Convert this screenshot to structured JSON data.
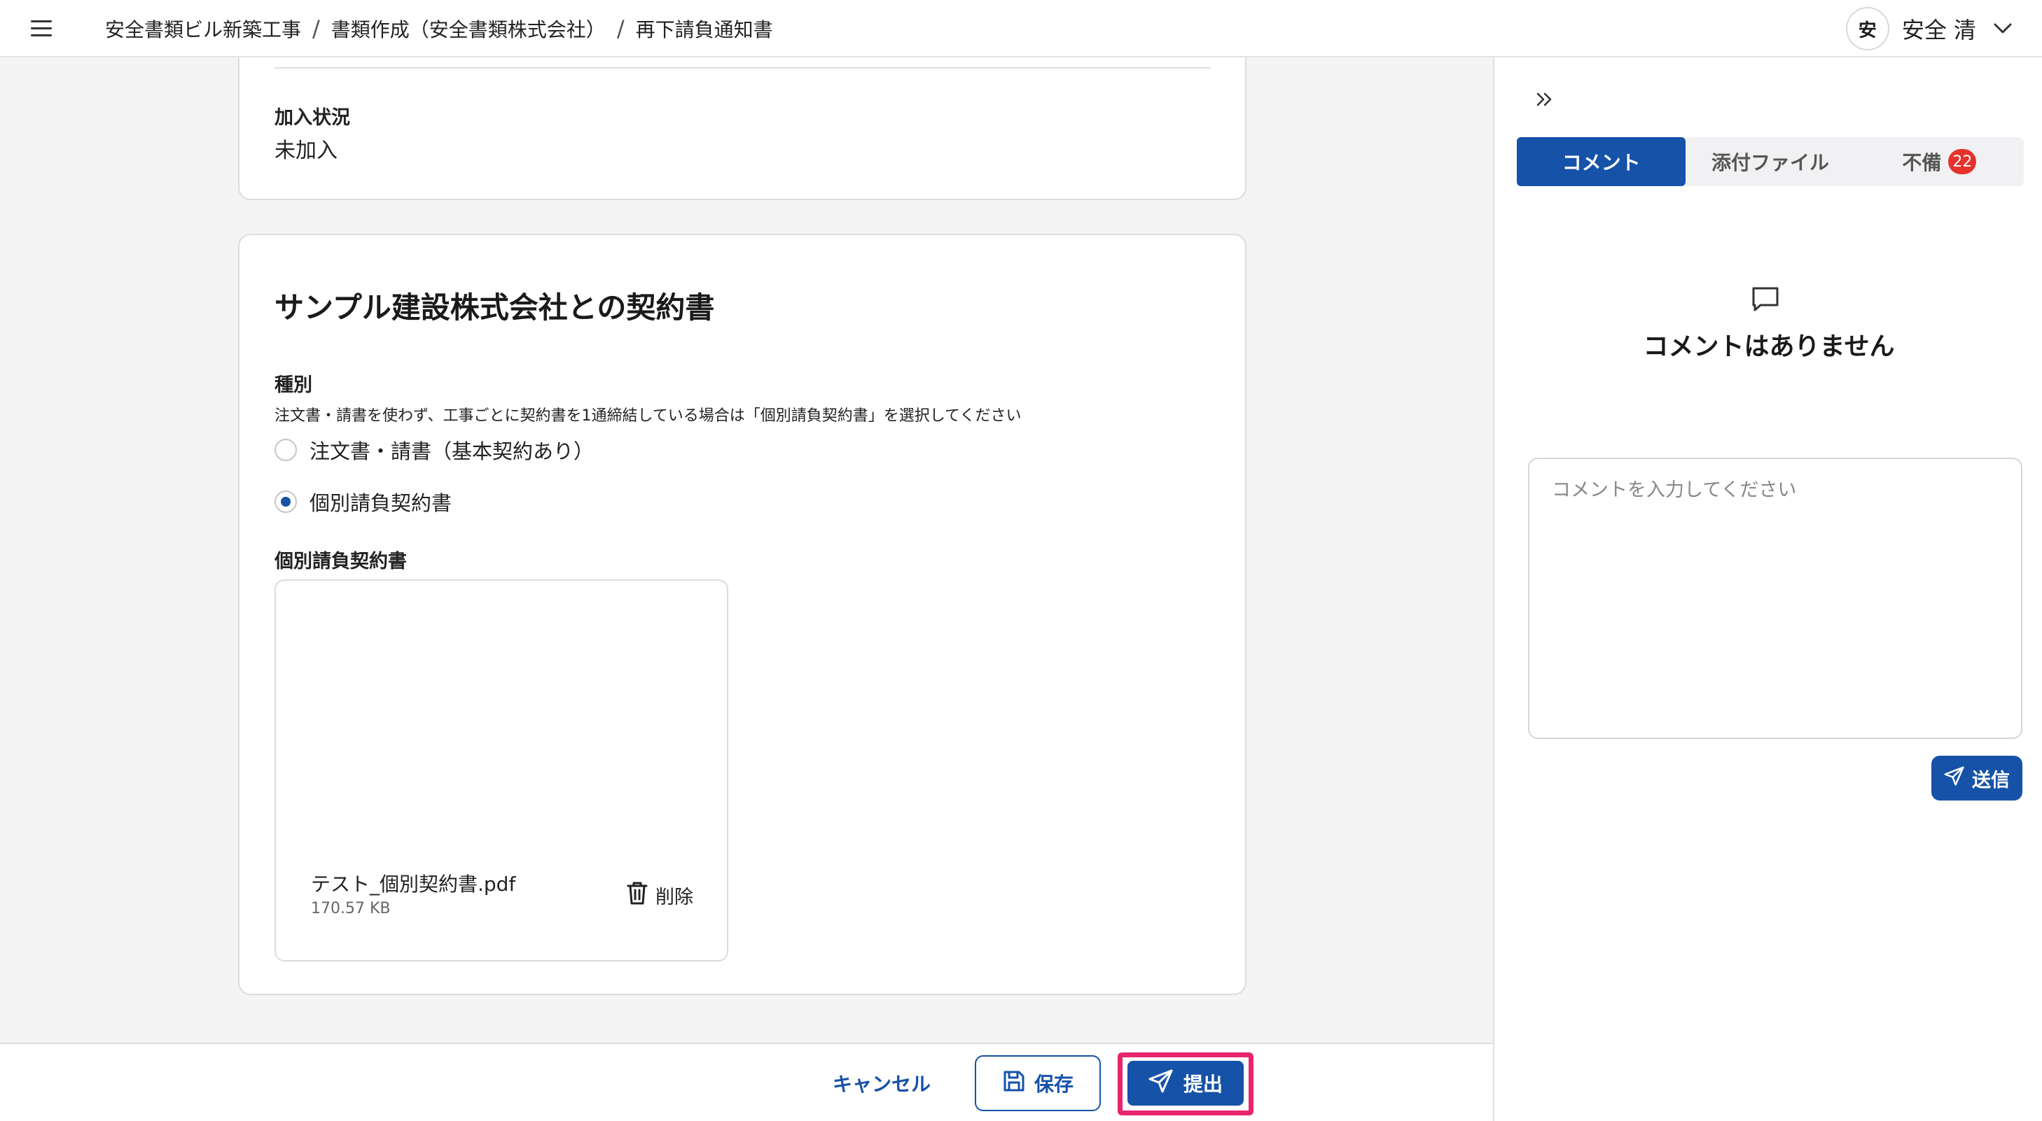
{
  "header": {
    "breadcrumbs": [
      "安全書類ビル新築工事",
      "書類作成（安全書類株式会社）",
      "再下請負通知書"
    ],
    "separator": "/",
    "user": {
      "avatar_text": "安",
      "name": "安全 清"
    }
  },
  "card1": {
    "label": "加入状況",
    "value": "未加入"
  },
  "contract_card": {
    "title": "サンプル建設株式会社との契約書",
    "type_label": "種別",
    "type_help": "注文書・請書を使わず、工事ごとに契約書を1通締結している場合は「個別請負契約書」を選択してください",
    "options": [
      {
        "label": "注文書・請書（基本契約あり）",
        "checked": false
      },
      {
        "label": "個別請負契約書",
        "checked": true
      }
    ],
    "file_section_label": "個別請負契約書",
    "file": {
      "name": "テスト_個別契約書.pdf",
      "size": "170.57 KB",
      "delete_label": "削除"
    }
  },
  "footer": {
    "cancel_label": "キャンセル",
    "save_label": "保存",
    "submit_label": "提出"
  },
  "right_panel": {
    "tabs": [
      {
        "label": "コメント",
        "active": true
      },
      {
        "label": "添付ファイル",
        "active": false
      },
      {
        "label": "不備",
        "active": false,
        "badge": "22"
      }
    ],
    "empty_message": "コメントはありません",
    "comment_placeholder": "コメントを入力してください",
    "send_label": "送信"
  },
  "colors": {
    "primary": "#1552a8",
    "highlight": "#e8266d",
    "badge": "#e5322d"
  }
}
